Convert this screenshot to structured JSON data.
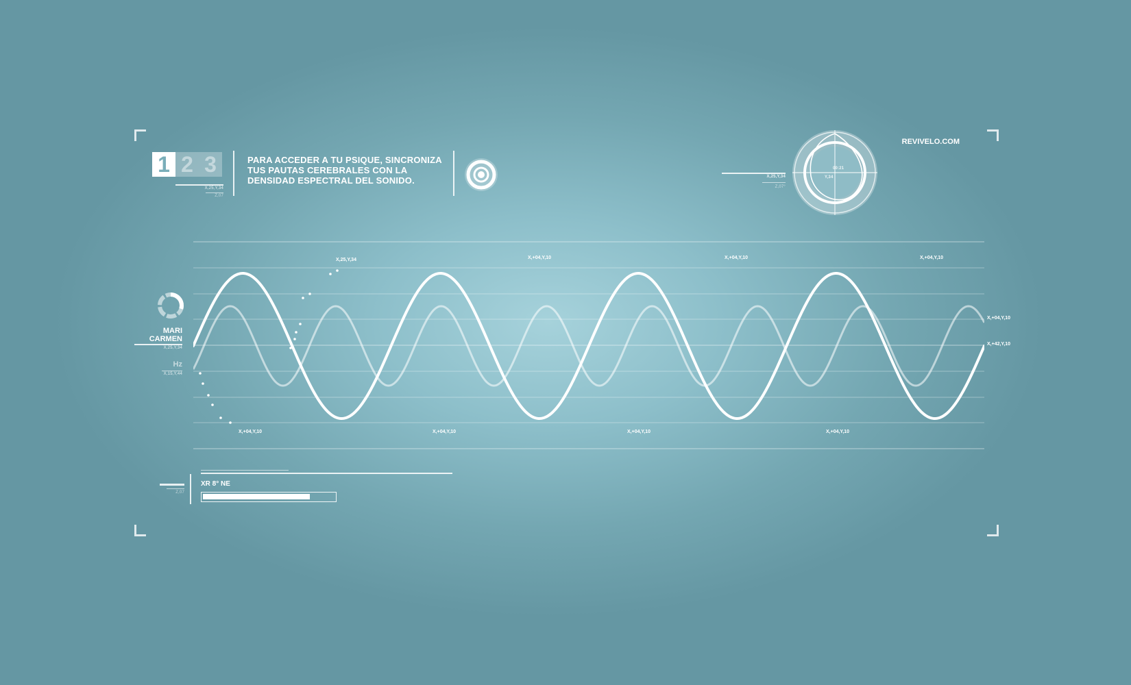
{
  "steps": [
    {
      "label": "1",
      "active": true
    },
    {
      "label": "2",
      "active": false
    },
    {
      "label": "3",
      "active": false
    }
  ],
  "step_caption": "X,25,Y,34",
  "step_sub": "Z,07",
  "instruction": "PARA ACCEDER A TU PSIQUE, SINCRONIZA TUS PAUTAS CEREBRALES CON LA DENSIDAD ESPECTRAL DEL SONIDO.",
  "brand": "REVIVELO.COM",
  "dial": {
    "time": "00:21",
    "y_label": "Y,34",
    "coord": "X,25,Y,34",
    "sub": "Z,07°"
  },
  "user": {
    "name_line1": "MARI",
    "name_line2": "CARMEN",
    "coord": "X,25,Y,34",
    "unit": "Hz",
    "unit_coord": "X,15,Y,44"
  },
  "wave": {
    "labels_top": [
      "X,25,Y,34",
      "X,+04,Y,10",
      "X,+04,Y,10",
      "X,+04,Y,10"
    ],
    "labels_bottom": [
      "X,+04,Y,10",
      "X,+04,Y,10",
      "X,+04,Y,10",
      "X,+04,Y,10"
    ],
    "labels_right": [
      "X,+04,Y,10",
      "X,+42,Y,10"
    ],
    "primary_cycles": 4,
    "secondary_cycles": 7.5
  },
  "status": {
    "label": "XR 8° NE",
    "progress": 0.81,
    "sub": "Z,07"
  },
  "colors": {
    "accent": "#ffffff",
    "background": "#7aaeb9"
  }
}
